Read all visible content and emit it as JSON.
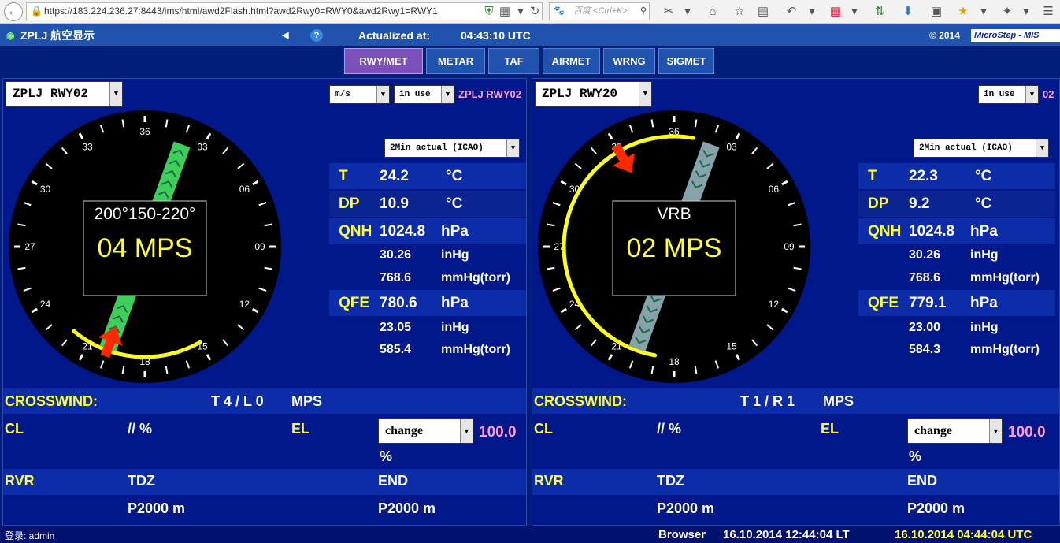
{
  "browser": {
    "url": "https://183.224.236.27:8443/ims/html/awd2Flash.html?awd2Rwy0=RWY0&awd2Rwy1=RWY1",
    "search_placeholder": "百度 <Ctrl+K>"
  },
  "header": {
    "title": "ZPLJ 航空显示",
    "actualized_label": "Actualized at:",
    "actualized_time": "04:43:10 UTC",
    "copyright": "© 2014",
    "brand": "MicroStep - MIS"
  },
  "tabs": [
    "RWY/MET",
    "METAR",
    "TAF",
    "AIRMET",
    "WRNG",
    "SIGMET"
  ],
  "active_tab": "RWY/MET",
  "panels": [
    {
      "runway_select": "ZPLJ RWY02",
      "unit_select": "m/s",
      "use_select": "in use",
      "runway_label": "ZPLJ RWY02",
      "mode_select": "2Min actual (ICAO)",
      "wind": {
        "direction_text": "200°150-220°",
        "speed_text": "04 MPS",
        "runway_heading_deg": 20,
        "wind_from_deg": 200,
        "wind_min_deg": 150,
        "wind_max_deg": 220,
        "arrow_color": "#ff2a00",
        "runway_color": "#3ecf5a"
      },
      "met": {
        "t_label": "T",
        "t_value": "24.2",
        "t_unit": "°C",
        "dp_label": "DP",
        "dp_value": "10.9",
        "dp_unit": "°C",
        "qnh_label": "QNH",
        "qnh_hpa": "1024.8",
        "qnh_hpa_unit": "hPa",
        "qnh_inhg": "30.26",
        "qnh_inhg_unit": "inHg",
        "qnh_mmhg": "768.6",
        "qnh_mmhg_unit": "mmHg(torr)",
        "qfe_label": "QFE",
        "qfe_hpa": "780.6",
        "qfe_hpa_unit": "hPa",
        "qfe_inhg": "23.05",
        "qfe_inhg_unit": "inHg",
        "qfe_mmhg": "585.4",
        "qfe_mmhg_unit": "mmHg(torr)"
      },
      "crosswind_label": "CROSSWIND:",
      "crosswind_value": "T 4 / L 0",
      "crosswind_unit": "MPS",
      "cl_label": "CL",
      "cl_value": "// %",
      "el_label": "EL",
      "el_select": "change",
      "el_value": "100.0",
      "el_unit": "%",
      "rvr_label": "RVR",
      "tdz_label": "TDZ",
      "end_label": "END",
      "tdz_value": "P2000 m",
      "end_value": "P2000 m"
    },
    {
      "runway_select": "ZPLJ RWY20",
      "use_select": "in use",
      "runway_label": "02",
      "mode_select": "2Min actual (ICAO)",
      "wind": {
        "direction_text": "VRB",
        "speed_text": "02 MPS",
        "runway_heading_deg": 200,
        "wind_from_deg": 330,
        "wind_min_deg": 190,
        "wind_max_deg": 10,
        "arrow_color": "#ff2a00",
        "runway_color": "#86a3aa"
      },
      "met": {
        "t_label": "T",
        "t_value": "22.3",
        "t_unit": "°C",
        "dp_label": "DP",
        "dp_value": "9.2",
        "dp_unit": "°C",
        "qnh_label": "QNH",
        "qnh_hpa": "1024.8",
        "qnh_hpa_unit": "hPa",
        "qnh_inhg": "30.26",
        "qnh_inhg_unit": "inHg",
        "qnh_mmhg": "768.6",
        "qnh_mmhg_unit": "mmHg(torr)",
        "qfe_label": "QFE",
        "qfe_hpa": "779.1",
        "qfe_hpa_unit": "hPa",
        "qfe_inhg": "23.00",
        "qfe_inhg_unit": "inHg",
        "qfe_mmhg": "584.3",
        "qfe_mmhg_unit": "mmHg(torr)"
      },
      "crosswind_label": "CROSSWIND:",
      "crosswind_value": "T 1 / R 1",
      "crosswind_unit": "MPS",
      "cl_label": "CL",
      "cl_value": "// %",
      "el_label": "EL",
      "el_select": "change",
      "el_value": "100.0",
      "el_unit": "%",
      "rvr_label": "RVR",
      "tdz_label": "TDZ",
      "end_label": "END",
      "tdz_value": "P2000 m",
      "end_value": "P2000 m"
    }
  ],
  "compass_labels": [
    "36",
    "03",
    "06",
    "09",
    "12",
    "15",
    "18",
    "21",
    "24",
    "27",
    "30",
    "33"
  ],
  "footer": {
    "login": "登录: admin",
    "browser_label": "Browser",
    "local_time": "16.10.2014 12:44:04 LT",
    "utc_time": "16.10.2014 04:44:04 UTC"
  }
}
